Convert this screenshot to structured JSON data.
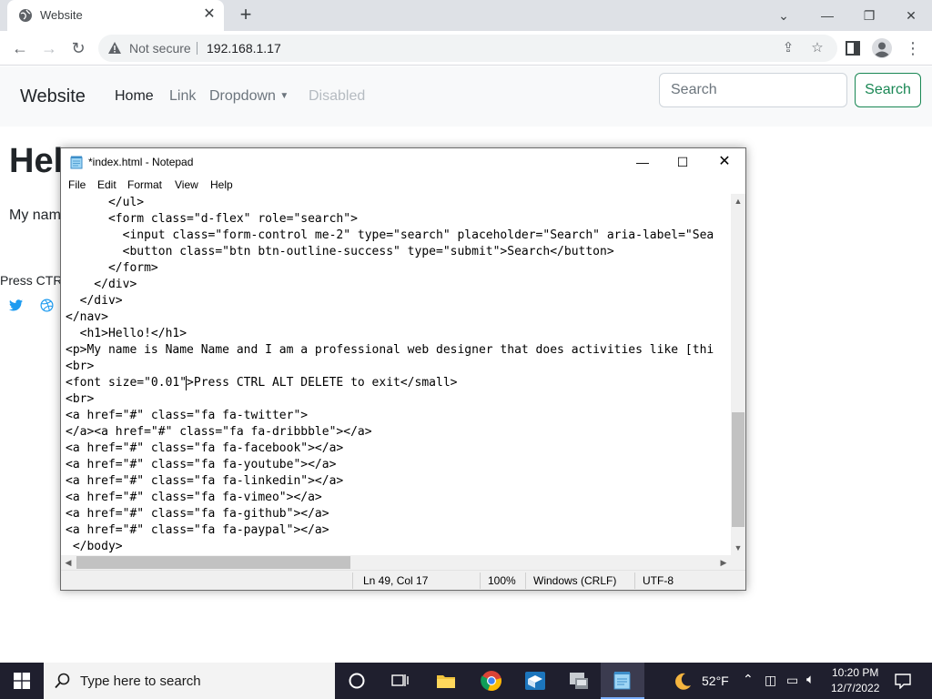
{
  "browser": {
    "tab_title": "Website",
    "address_security": "Not secure",
    "address_url": "192.168.1.17"
  },
  "site": {
    "brand": "Website",
    "nav_links": [
      "Home",
      "Link",
      "Dropdown",
      "Disabled"
    ],
    "search_placeholder": "Search",
    "search_button": "Search",
    "heading_partial": "Hel",
    "paragraph_partial": "My nam",
    "press_partial": "Press CTRL"
  },
  "notepad": {
    "title": "*index.html - Notepad",
    "menu": [
      "File",
      "Edit",
      "Format",
      "View",
      "Help"
    ],
    "lines": [
      "      </ul>",
      "      <form class=\"d-flex\" role=\"search\">",
      "        <input class=\"form-control me-2\" type=\"search\" placeholder=\"Search\" aria-label=\"Sea",
      "        <button class=\"btn btn-outline-success\" type=\"submit\">Search</button>",
      "      </form>",
      "    </div>",
      "  </div>",
      "</nav>",
      "  <h1>Hello!</h1>",
      "<p>My name is Name Name and I am a professional web designer that does activities like [thi",
      "<br>",
      "<font size=\"0.01\">Press CTRL ALT DELETE to exit</small>",
      "<br>",
      "<a href=\"#\" class=\"fa fa-twitter\">",
      "</a><a href=\"#\" class=\"fa fa-dribbble\"></a>",
      "<a href=\"#\" class=\"fa fa-facebook\"></a>",
      "<a href=\"#\" class=\"fa fa-youtube\"></a>",
      "<a href=\"#\" class=\"fa fa-linkedin\"></a>",
      "<a href=\"#\" class=\"fa fa-vimeo\"></a>",
      "<a href=\"#\" class=\"fa fa-github\"></a>",
      "<a href=\"#\" class=\"fa fa-paypal\"></a>",
      " </body>"
    ],
    "status": {
      "position": "Ln 49, Col 17",
      "zoom": "100%",
      "line_ending": "Windows (CRLF)",
      "encoding": "UTF-8"
    }
  },
  "taskbar": {
    "search_placeholder": "Type here to search",
    "weather": "52°F",
    "time": "10:20 PM",
    "date": "12/7/2022"
  },
  "colors": {
    "bootstrap_success": "#198754",
    "taskbar_bg": "#1f1f2e",
    "chrome_tabstrip": "#dee1e6"
  }
}
